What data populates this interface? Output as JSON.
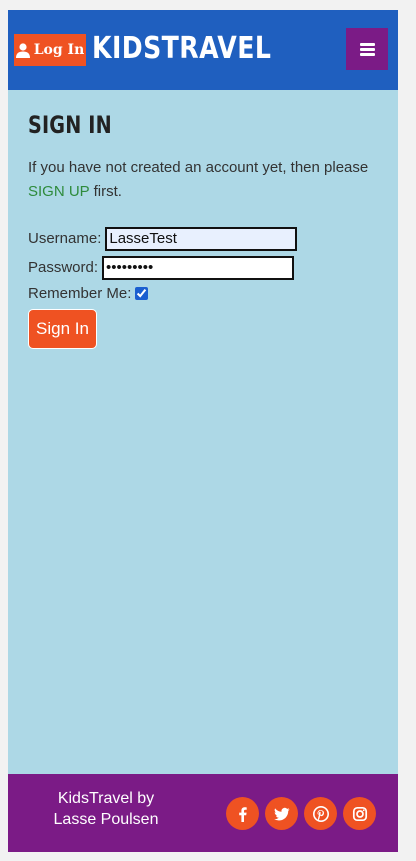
{
  "header": {
    "login_label": "Log In",
    "brand": "KIDSTRAVEL",
    "login_icon": "user-icon",
    "menu_icon": "hamburger-menu-icon"
  },
  "main": {
    "title": "SIGN IN",
    "intro_before": "If you have not created an account yet, then please ",
    "signup_link": "SIGN UP",
    "intro_after": " first.",
    "username_label": "Username:",
    "username_value": "LasseTest",
    "password_label": "Password:",
    "password_value": "passwordx",
    "remember_label": "Remember Me:",
    "remember_checked": true,
    "signin_label": "Sign In"
  },
  "footer": {
    "line1": "KidsTravel by",
    "line2": "Lasse Poulsen",
    "social_icons": [
      "facebook-icon",
      "twitter-icon",
      "pinterest-icon",
      "instagram-icon"
    ]
  },
  "colors": {
    "header_bg": "#1f5fbf",
    "page_bg": "#add8e6",
    "accent_orange": "#ef5222",
    "purple": "#7b1b86",
    "link_green": "#2e8b3c"
  }
}
